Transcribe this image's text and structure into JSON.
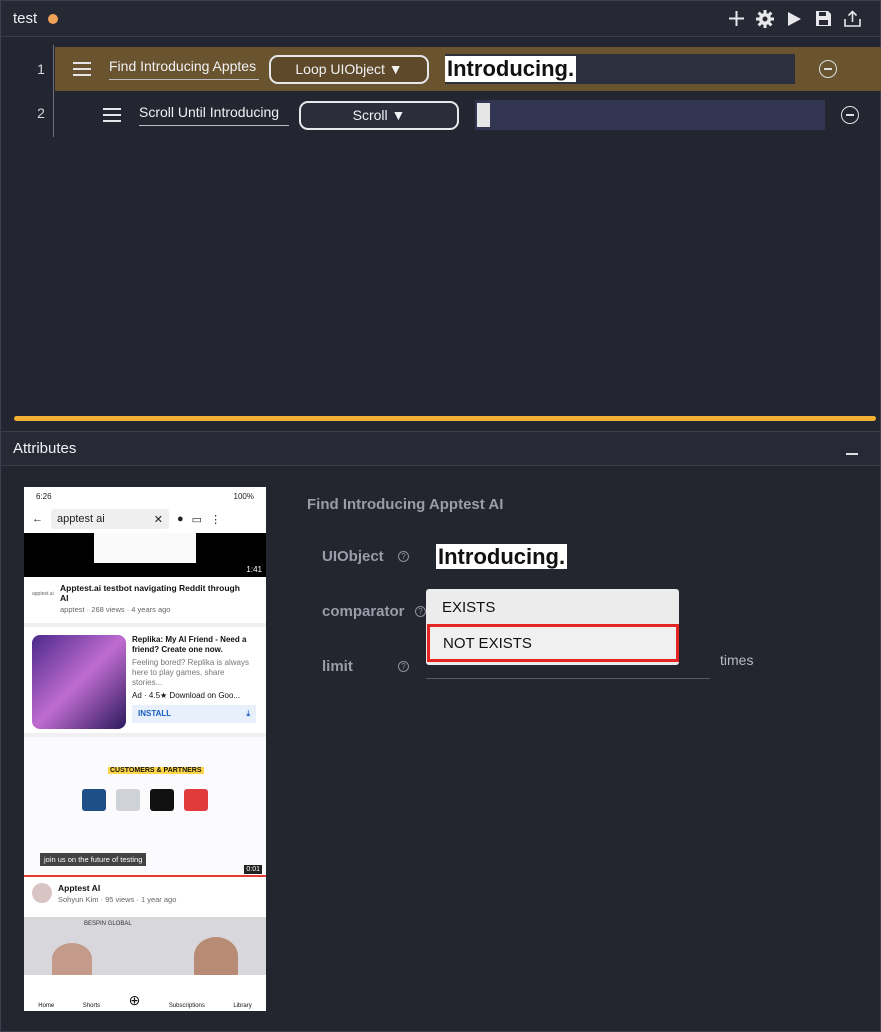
{
  "window": {
    "title": "test",
    "unsaved_dot_color": "#f0a058",
    "tools": [
      "plus-icon",
      "gear-icon",
      "play-icon",
      "save-icon",
      "export-icon"
    ]
  },
  "steps": [
    {
      "num": "1",
      "label": "Find Introducing Apptes",
      "action": "Loop UIObject ▼",
      "value": "Introducing."
    },
    {
      "num": "2",
      "label": "Scroll Until Introducing",
      "action": "Scroll ▼",
      "value": ""
    }
  ],
  "attributes": {
    "header": "Attributes",
    "phone": {
      "time": "6:26",
      "battery": "100%",
      "search_query": "apptest ai",
      "video1_duration": "1:41",
      "video1_channel_logo": "apptest.ai",
      "video1_title": "Apptest.ai testbot navigating Reddit through AI",
      "video1_meta": "apptest · 268 views · 4 years ago",
      "ad_title": "Replika: My AI Friend - Need a friend? Create one now.",
      "ad_desc": "Feeling bored? Replika is always here to play games, share stories...",
      "ad_meta": "Ad · 4.5★  Download on Goo...",
      "ad_install": "INSTALL",
      "partners_heading": "CUSTOMERS & PARTNERS",
      "caption": "join us on the future of testing",
      "video2_time": "0:01",
      "channel_title": "Apptest AI",
      "channel_meta": "Sohyun Kim · 95 views · 1 year ago",
      "watermark": "BESPIN GLOBAL",
      "nav": [
        "Home",
        "Shorts",
        "",
        "Subscriptions",
        "Library"
      ]
    },
    "form": {
      "title": "Find Introducing Apptest AI",
      "uiobject_label": "UIObject",
      "uiobject_value": "Introducing.",
      "comparator_label": "comparator",
      "limit_label": "limit",
      "limit_unit": "times",
      "comparator_options": [
        "EXISTS",
        "NOT EXISTS"
      ],
      "highlight_color": "#e52424"
    }
  }
}
